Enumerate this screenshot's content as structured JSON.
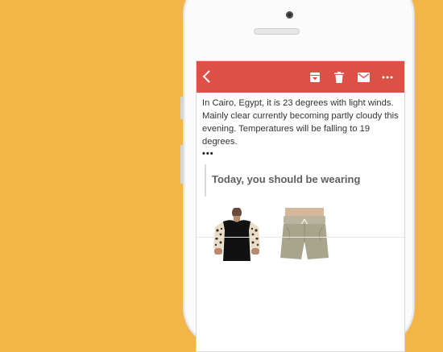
{
  "email": {
    "body": "In Cairo, Egypt, it is 23 degrees with light winds. Mainly clear currently becoming partly cloudy this evening. Temperatures will be falling to 19 degrees.",
    "more": "•••",
    "section_title": "Today, you should be wearing"
  },
  "toolbar": {
    "icons": [
      "back-icon",
      "archive-icon",
      "delete-icon",
      "mail-icon",
      "more-icon"
    ]
  },
  "colors": {
    "background": "#f4b548",
    "appbar": "#dc5045"
  },
  "products": [
    {
      "icon": "black-tshirt-image"
    },
    {
      "icon": "khaki-shorts-image"
    }
  ]
}
